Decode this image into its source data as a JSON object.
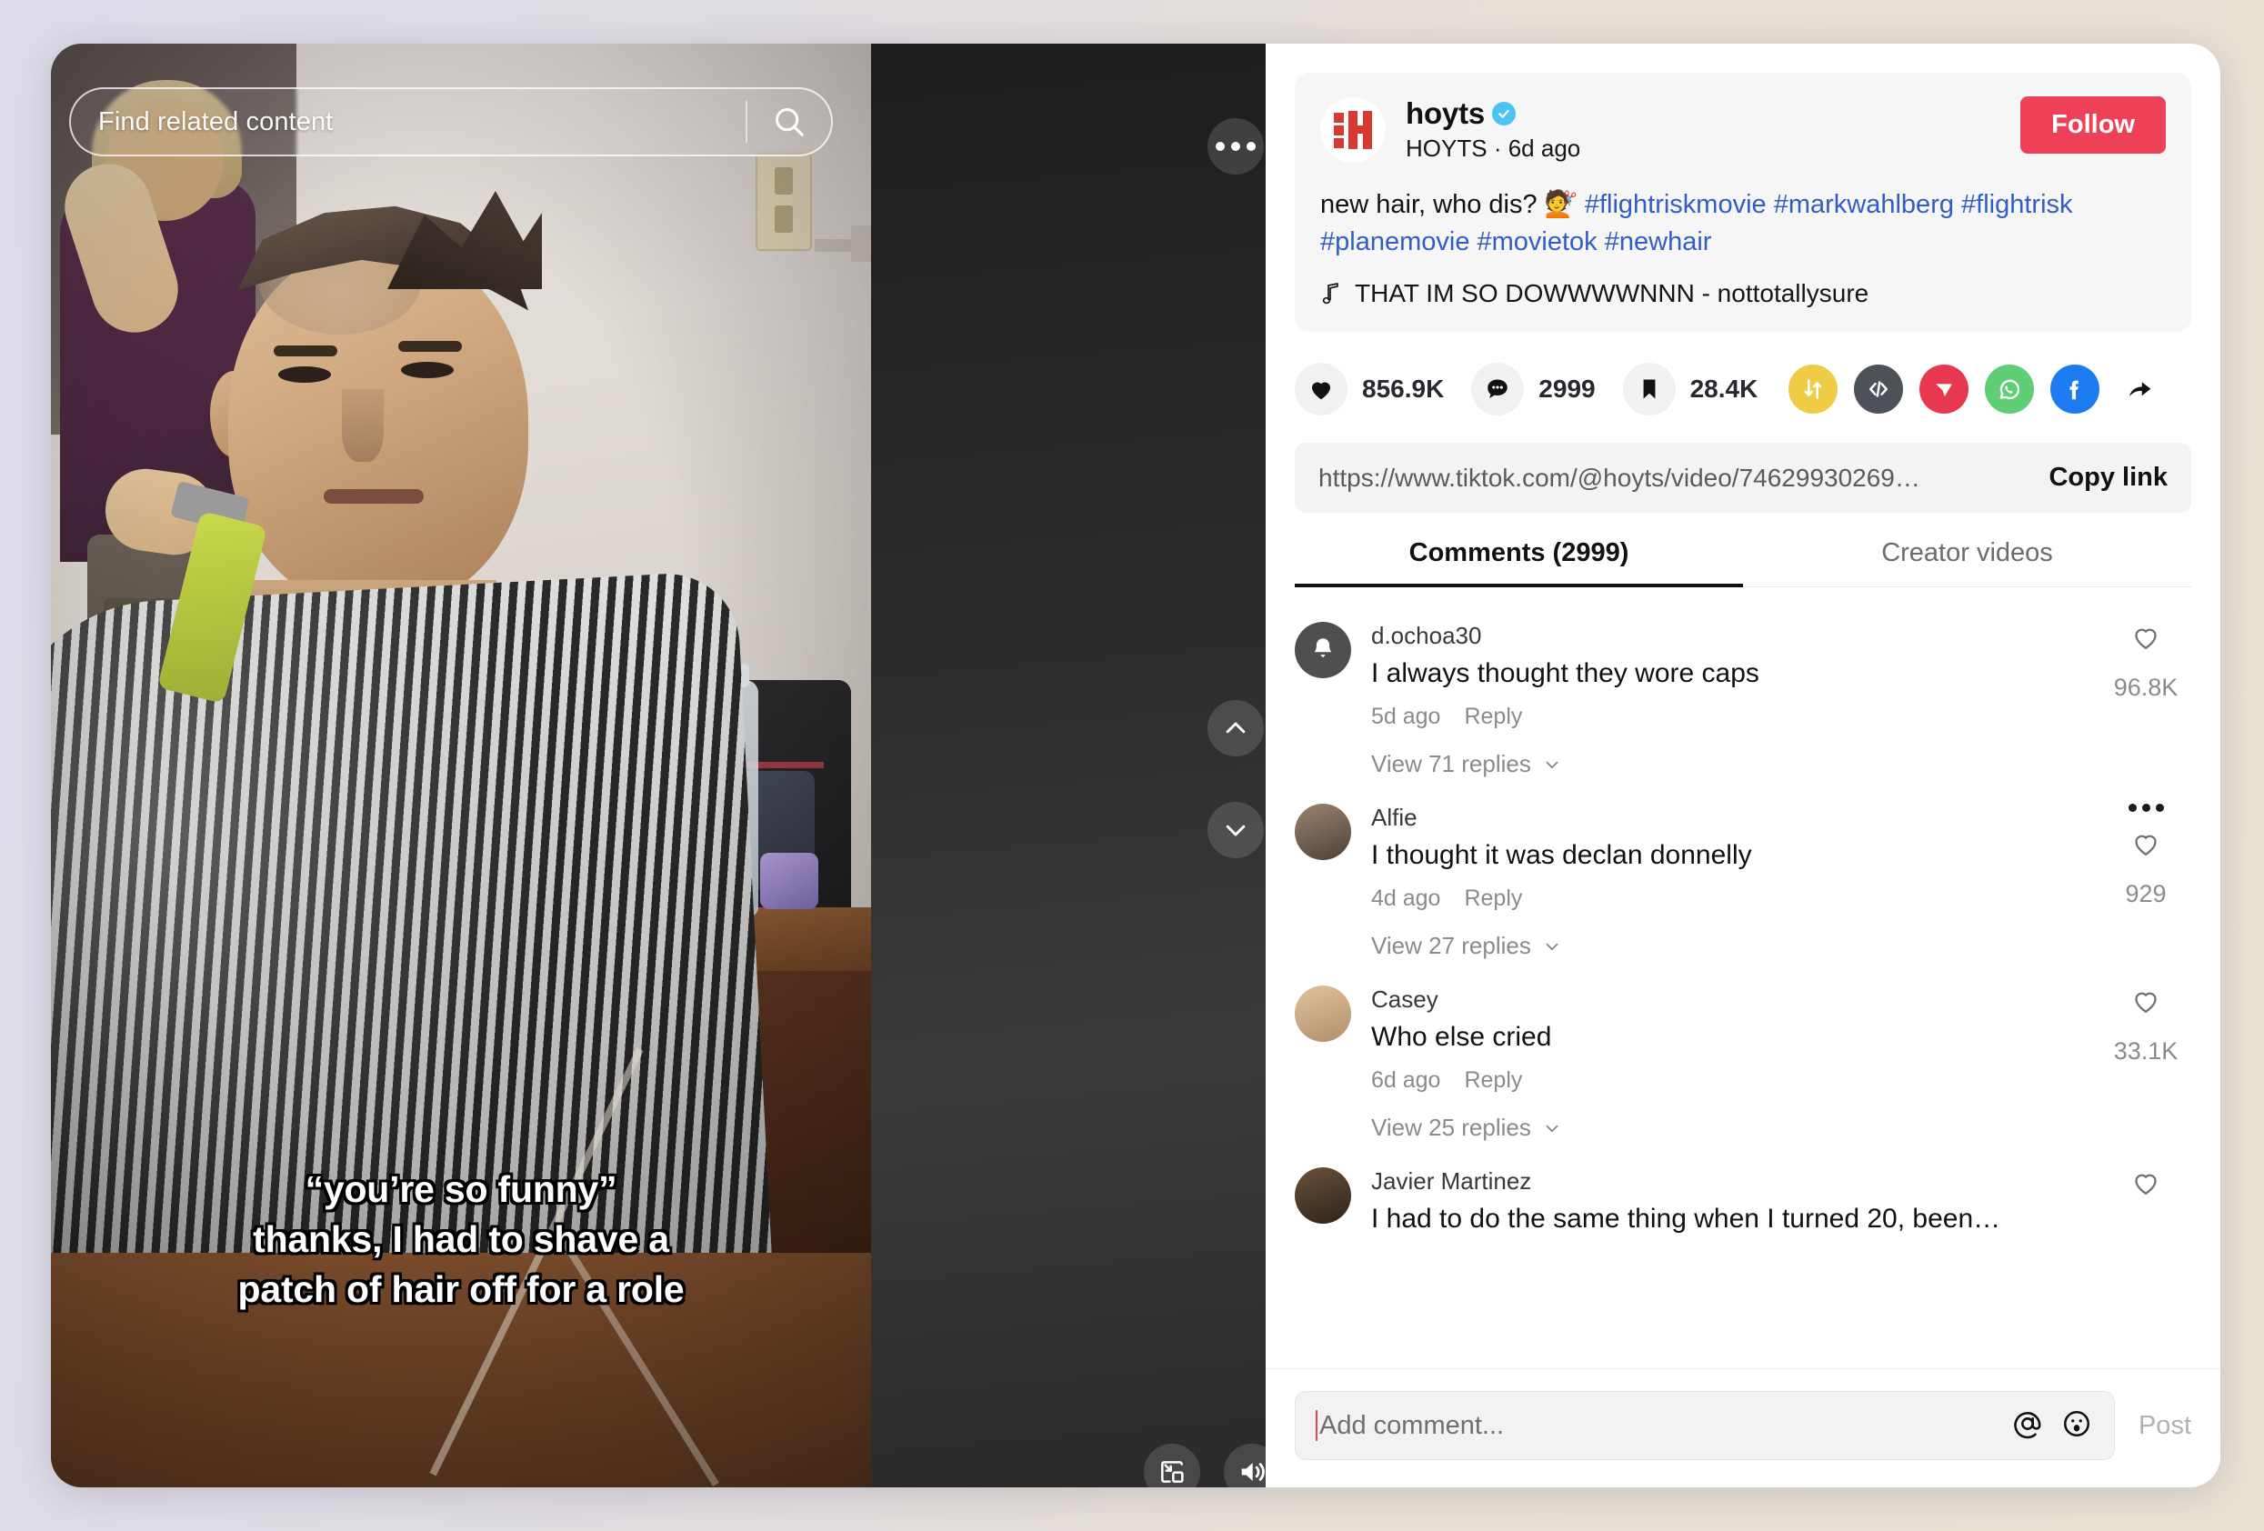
{
  "video": {
    "search_placeholder": "Find related content",
    "search_icon": "search-icon",
    "more_icon": "more-horizontal-icon",
    "prev_icon": "chevron-up-icon",
    "next_icon": "chevron-down-icon",
    "pip_icon": "picture-in-picture-icon",
    "volume_icon": "volume-on-icon",
    "caption_lines": [
      "“you’re so funny”",
      "thanks, I had to shave a",
      "patch of hair off for a role"
    ]
  },
  "post": {
    "author_handle": "hoyts",
    "verified_icon": "verified-badge-icon",
    "author_name": "HOYTS",
    "separator": "·",
    "posted_ago": "6d ago",
    "follow_label": "Follow",
    "description_text": "new hair, who dis? 💇",
    "hashtags": [
      "#flightriskmovie",
      "#markwahlberg",
      "#flightrisk",
      "#planemovie",
      "#movietok",
      "#newhair"
    ],
    "music_icon": "music-note-icon",
    "music_label": "THAT IM SO DOWWWWNNN - nottotallysure",
    "accent_color": "#EE4157",
    "hashtag_color": "#2F5EC4"
  },
  "actions": {
    "like": {
      "icon": "heart-filled-icon",
      "count": "856.9K"
    },
    "comment": {
      "icon": "comment-bubble-icon",
      "count": "2999"
    },
    "bookmark": {
      "icon": "bookmark-filled-icon",
      "count": "28.4K"
    },
    "share_icons": [
      {
        "name": "repost-icon",
        "color": "#F0CB45"
      },
      {
        "name": "embed-code-icon",
        "color": "#4D5158"
      },
      {
        "name": "telegram-icon",
        "color": "#E8384F"
      },
      {
        "name": "whatsapp-icon",
        "color": "#5FCE74"
      },
      {
        "name": "facebook-icon",
        "color": "#1D7CF2"
      },
      {
        "name": "share-arrow-icon",
        "color": "#000000"
      }
    ]
  },
  "link": {
    "url": "https://www.tiktok.com/@hoyts/video/74629930269…",
    "copy_label": "Copy link"
  },
  "tabs": [
    {
      "label": "Comments (2999)",
      "active": true
    },
    {
      "label": "Creator videos",
      "active": false
    }
  ],
  "comments": [
    {
      "name": "d.ochoa30",
      "avatar": "bell-avatar",
      "text": "I always thought they wore caps",
      "time": "5d ago",
      "reply_label": "Reply",
      "likes": "96.8K",
      "replies_label": "View 71 replies",
      "has_menu": false
    },
    {
      "name": "Alfie",
      "avatar": "photo-avatar-1",
      "text": "I thought it was declan donnelly",
      "time": "4d ago",
      "reply_label": "Reply",
      "likes": "929",
      "replies_label": "View 27 replies",
      "has_menu": true
    },
    {
      "name": "Casey",
      "avatar": "photo-avatar-2",
      "text": "Who else cried",
      "time": "6d ago",
      "reply_label": "Reply",
      "likes": "33.1K",
      "replies_label": "View 25 replies",
      "has_menu": false
    },
    {
      "name": "Javier Martinez",
      "avatar": "photo-avatar-3",
      "text": "I had to do the same thing when I turned 20, been…",
      "time": "",
      "reply_label": "",
      "likes": "",
      "replies_label": "",
      "has_menu": false
    }
  ],
  "composer": {
    "placeholder": "Add comment...",
    "mention_icon": "at-mention-icon",
    "emoji_icon": "emoji-face-icon",
    "post_label": "Post"
  }
}
